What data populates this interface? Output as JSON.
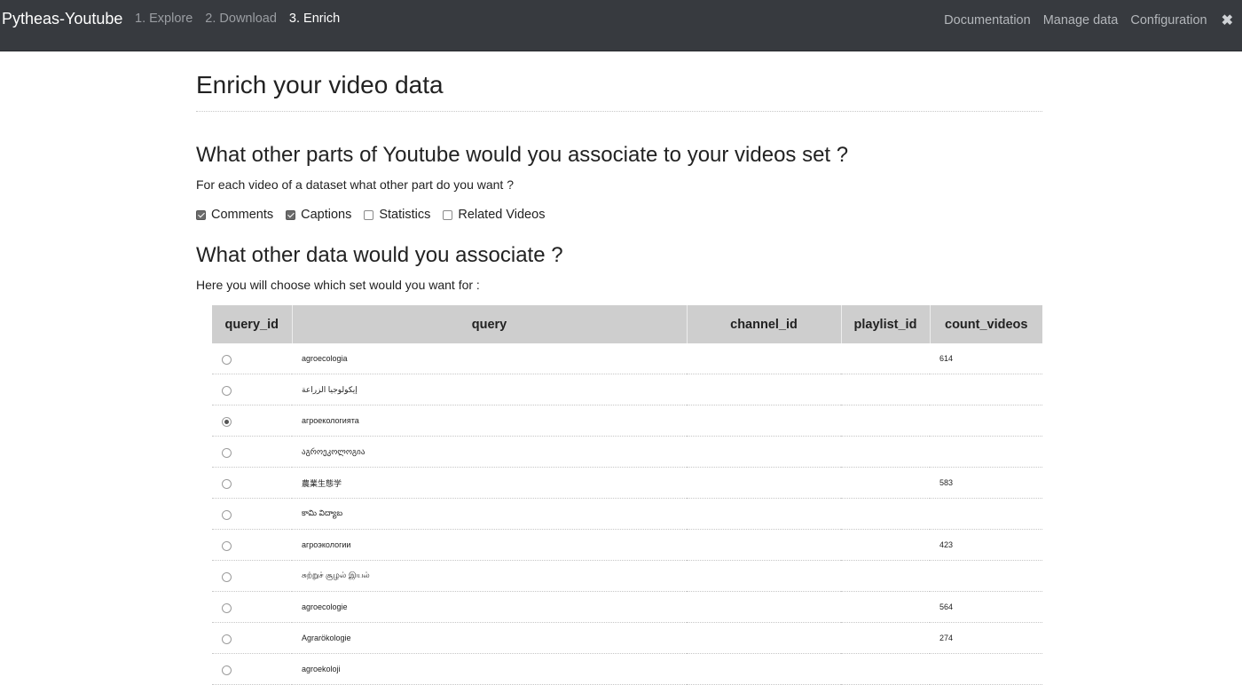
{
  "navbar": {
    "brand": "Pytheas-Youtube",
    "steps": [
      "1. Explore",
      "2. Download",
      "3. Enrich"
    ],
    "active_step": 2,
    "right_links": [
      "Documentation",
      "Manage data",
      "Configuration"
    ],
    "close_glyph": "✖"
  },
  "page": {
    "title": "Enrich your video data",
    "section1": {
      "heading": "What other parts of Youtube would you associate to your videos set ?",
      "text": "For each video of a dataset what other part do you want ?",
      "options": [
        {
          "label": "Comments",
          "checked": true
        },
        {
          "label": "Captions",
          "checked": true
        },
        {
          "label": "Statistics",
          "checked": false
        },
        {
          "label": "Related Videos",
          "checked": false
        }
      ]
    },
    "section2": {
      "heading": "What other data would you associate ?",
      "text": "Here you will choose which set would you want for :"
    }
  },
  "table": {
    "headers": [
      "query_id",
      "query",
      "channel_id",
      "playlist_id",
      "count_videos"
    ],
    "rows": [
      {
        "selected": false,
        "query": "agroecologia",
        "channel_id": "",
        "playlist_id": "",
        "count_videos": "614"
      },
      {
        "selected": false,
        "query": "إيكولوجيا الزراعة",
        "channel_id": "",
        "playlist_id": "",
        "count_videos": ""
      },
      {
        "selected": true,
        "query": "агроекологията",
        "channel_id": "",
        "playlist_id": "",
        "count_videos": ""
      },
      {
        "selected": false,
        "query": "აგროეკოლოგია",
        "channel_id": "",
        "playlist_id": "",
        "count_videos": ""
      },
      {
        "selected": false,
        "query": "農業生態学",
        "channel_id": "",
        "playlist_id": "",
        "count_videos": "583"
      },
      {
        "selected": false,
        "query": "కామి విద్యాబ",
        "channel_id": "",
        "playlist_id": "",
        "count_videos": ""
      },
      {
        "selected": false,
        "query": "агроэкологии",
        "channel_id": "",
        "playlist_id": "",
        "count_videos": "423"
      },
      {
        "selected": false,
        "query": "சுற்றுச் சூழல் இயல்",
        "channel_id": "",
        "playlist_id": "",
        "count_videos": ""
      },
      {
        "selected": false,
        "query": "agroecologie",
        "channel_id": "",
        "playlist_id": "",
        "count_videos": "564"
      },
      {
        "selected": false,
        "query": "Agrarökologie",
        "channel_id": "",
        "playlist_id": "",
        "count_videos": "274"
      },
      {
        "selected": false,
        "query": "agroekoloji",
        "channel_id": "",
        "playlist_id": "",
        "count_videos": ""
      }
    ]
  }
}
